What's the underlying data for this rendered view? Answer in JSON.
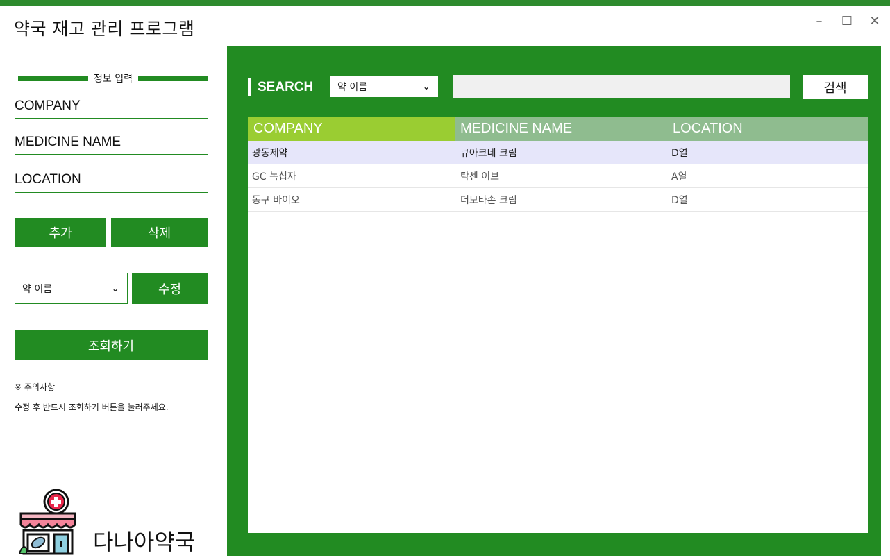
{
  "app": {
    "title": "약국 재고 관리 프로그램"
  },
  "window_controls": {
    "minimize": "–",
    "maximize": "☐",
    "close": "✕"
  },
  "left_panel": {
    "section_label": "정보 입력",
    "fields": {
      "company": "COMPANY",
      "medicine_name": "MEDICINE NAME",
      "location": "LOCATION"
    },
    "buttons": {
      "add": "추가",
      "delete": "삭제",
      "edit": "수정",
      "view": "조회하기"
    },
    "select": {
      "value": "약 이름"
    },
    "notice": {
      "title": "※ 주의사항",
      "text": "수정 후 반드시 조회하기 버튼을 눌러주세요."
    },
    "logo_text": "다나아약국"
  },
  "main_panel": {
    "search": {
      "label": "SEARCH",
      "select_value": "약 이름",
      "input_value": "",
      "button": "검색"
    },
    "table": {
      "headers": [
        "COMPANY",
        "MEDICINE NAME",
        "LOCATION"
      ],
      "rows": [
        {
          "company": "광동제약",
          "medicine": "큐아크네 크림",
          "location": "D열",
          "selected": true
        },
        {
          "company": "GC 녹십자",
          "medicine": "탁센 이브",
          "location": "A열",
          "selected": false
        },
        {
          "company": "동구 바이오",
          "medicine": "더모타손 크림",
          "location": "D열",
          "selected": false
        }
      ]
    }
  },
  "colors": {
    "brand_green": "#228b22",
    "header_lime": "#9acd32",
    "header_sage": "#8fbc8f",
    "selected_row": "#e6e6fa"
  }
}
